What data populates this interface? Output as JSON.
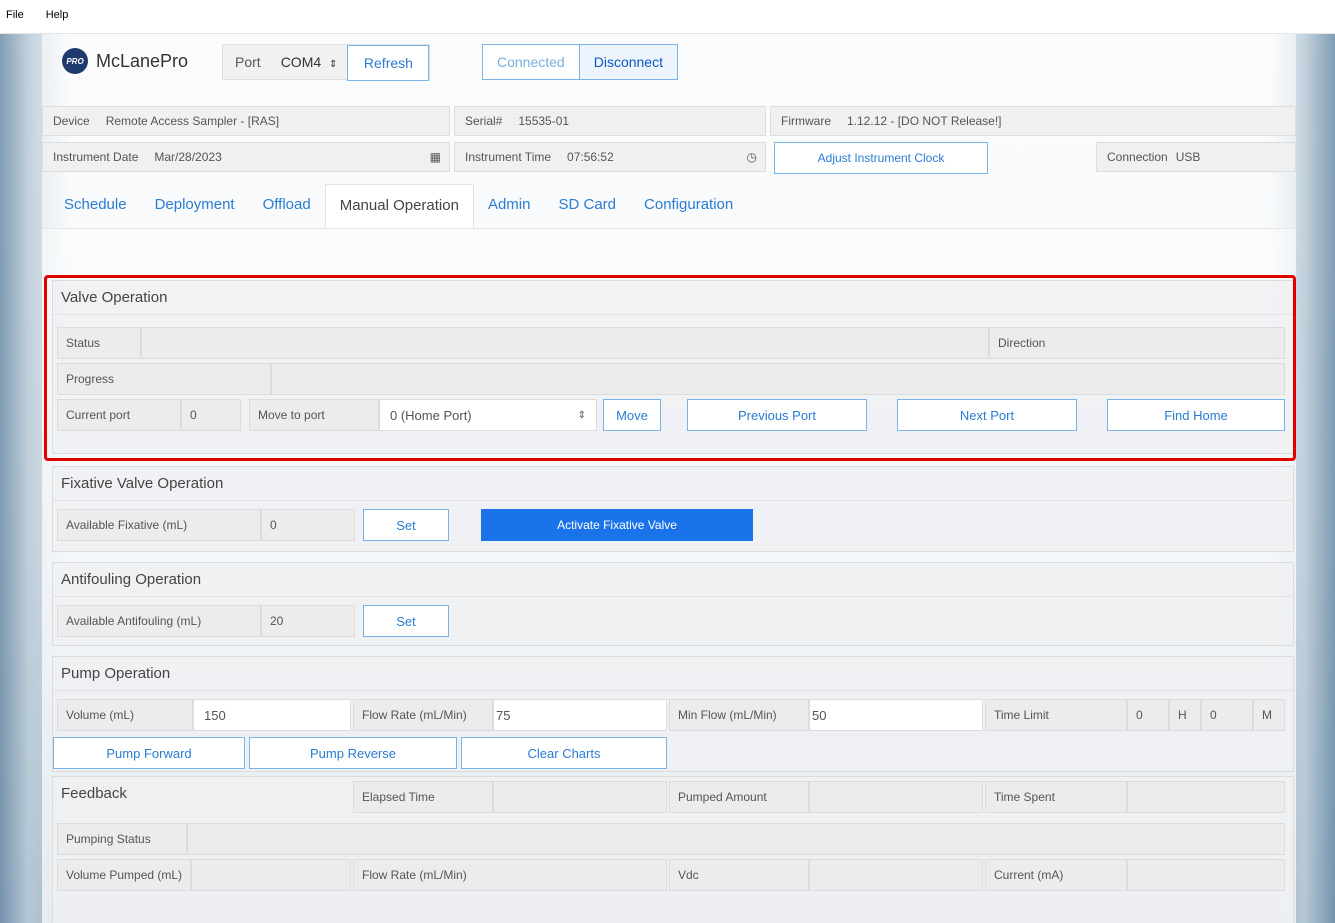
{
  "menu": {
    "file": "File",
    "help": "Help"
  },
  "brand": {
    "logo_text": "McLanePro",
    "badge": "PRO"
  },
  "connection": {
    "port_label": "Port",
    "port_value": "COM4",
    "refresh": "Refresh",
    "connected": "Connected",
    "disconnect": "Disconnect"
  },
  "device_info": {
    "device_label": "Device",
    "device_value": "Remote Access Sampler - [RAS]",
    "serial_label": "Serial#",
    "serial_value": "15535-01",
    "firmware_label": "Firmware",
    "firmware_value": "1.12.12 - [DO NOT Release!]",
    "date_label": "Instrument Date",
    "date_value": "Mar/28/2023",
    "time_label": "Instrument Time",
    "time_value": "07:56:52",
    "adjust_clock": "Adjust Instrument Clock",
    "connection_label": "Connection",
    "connection_value": "USB"
  },
  "tabs": [
    "Schedule",
    "Deployment",
    "Offload",
    "Manual Operation",
    "Admin",
    "SD Card",
    "Configuration"
  ],
  "active_tab": "Manual Operation",
  "valve_operation": {
    "title": "Valve Operation",
    "status_label": "Status",
    "direction_label": "Direction",
    "progress_label": "Progress",
    "current_port_label": "Current port",
    "current_port_value": "0",
    "move_to_port_label": "Move to port",
    "move_to_port_value": "0 (Home Port)",
    "move": "Move",
    "previous_port": "Previous Port",
    "next_port": "Next Port",
    "find_home": "Find Home"
  },
  "fixative": {
    "title": "Fixative Valve Operation",
    "available_label": "Available Fixative (mL)",
    "available_value": "0",
    "set": "Set",
    "activate": "Activate Fixative Valve"
  },
  "antifouling": {
    "title": "Antifouling Operation",
    "available_label": "Available Antifouling (mL)",
    "available_value": "20",
    "set": "Set"
  },
  "pump": {
    "title": "Pump Operation",
    "volume_label": "Volume (mL)",
    "volume_value": "150",
    "flow_label": "Flow Rate (mL/Min)",
    "flow_value": "75",
    "min_flow_label": "Min Flow (mL/Min)",
    "min_flow_value": "50",
    "time_limit_label": "Time Limit",
    "hours_value": "0",
    "hours_unit": "H",
    "minutes_value": "0",
    "minutes_unit": "M",
    "pump_forward": "Pump Forward",
    "pump_reverse": "Pump Reverse",
    "clear_charts": "Clear Charts"
  },
  "feedback": {
    "title": "Feedback",
    "elapsed_label": "Elapsed Time",
    "pumped_label": "Pumped Amount",
    "time_spent_label": "Time Spent",
    "pumping_status_label": "Pumping Status",
    "volume_pumped_label": "Volume Pumped (mL)",
    "flow_rate_label": "Flow Rate (mL/Min)",
    "vdc_label": "Vdc",
    "current_label": "Current (mA)"
  },
  "colors": {
    "accent": "#2b7cd3",
    "primary_button": "#1a73e8",
    "highlight": "#e00000"
  },
  "icons": [
    "calendar-icon",
    "clock-icon",
    "select-arrows-icon"
  ]
}
